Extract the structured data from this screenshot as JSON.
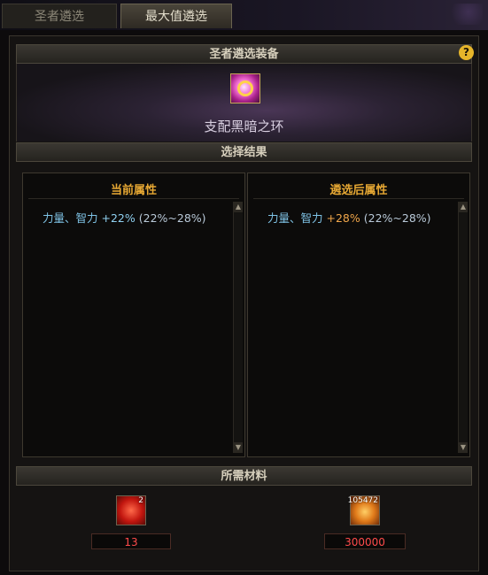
{
  "tabs": [
    {
      "label": "圣者遴选",
      "active": false
    },
    {
      "label": "最大值遴选",
      "active": true
    }
  ],
  "equipment_section": {
    "title": "圣者遴选装备",
    "item_name": "支配黑暗之环",
    "help_label": "?"
  },
  "result_section": {
    "title": "选择结果",
    "current": {
      "title": "当前属性",
      "attr_name": "力量、智力",
      "attr_value": "+22%",
      "attr_range": "(22%~28%)"
    },
    "after": {
      "title": "遴选后属性",
      "attr_name": "力量、智力",
      "attr_value": "+28%",
      "attr_range": "(22%~28%)"
    }
  },
  "materials_section": {
    "title": "所需材料",
    "items": [
      {
        "icon": "red-material-icon",
        "badge": "2",
        "count": "13"
      },
      {
        "icon": "gold-coin-icon",
        "badge": "105472",
        "count": "300000"
      }
    ]
  },
  "colors": {
    "accent_orange": "#e7a833",
    "attr_blue": "#7fc3e6",
    "value_orange": "#f0a64a",
    "count_red": "#ff4b4b"
  }
}
